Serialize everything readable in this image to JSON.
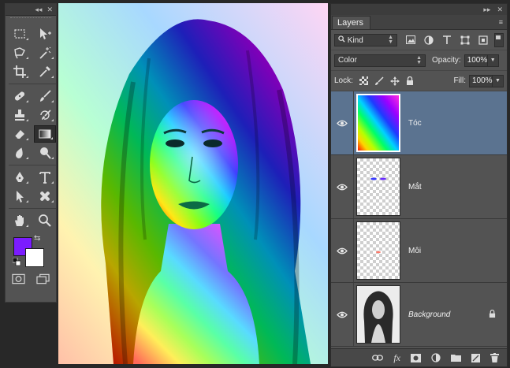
{
  "tools": {
    "topbar_collapse": "◂◂",
    "topbar_close": "✕",
    "foreground_color": "#7b1cff",
    "background_color": "#ffffff",
    "swap_glyph": "⇆"
  },
  "layers_panel": {
    "collapse": "▸▸",
    "close": "✕",
    "tab_label": "Layers",
    "menu_glyph": "≡",
    "filter_kind": "Kind",
    "blend_mode": "Color",
    "opacity_label": "Opacity:",
    "opacity_value": "100%",
    "lock_label": "Lock:",
    "fill_label": "Fill:",
    "fill_value": "100%",
    "layers": [
      {
        "name": "Tóc",
        "selected": true
      },
      {
        "name": "Mắt",
        "selected": false
      },
      {
        "name": "Môi",
        "selected": false
      },
      {
        "name": "Background",
        "selected": false,
        "locked": true
      }
    ],
    "bottom_icons": [
      "link-icon",
      "fx-icon",
      "mask-icon",
      "adjustment-icon",
      "folder-icon",
      "new-layer-icon",
      "trash-icon"
    ],
    "fx_label": "fx"
  },
  "colors": {
    "selected_layer_bg": "#5b7390",
    "panel_bg": "#535353"
  }
}
